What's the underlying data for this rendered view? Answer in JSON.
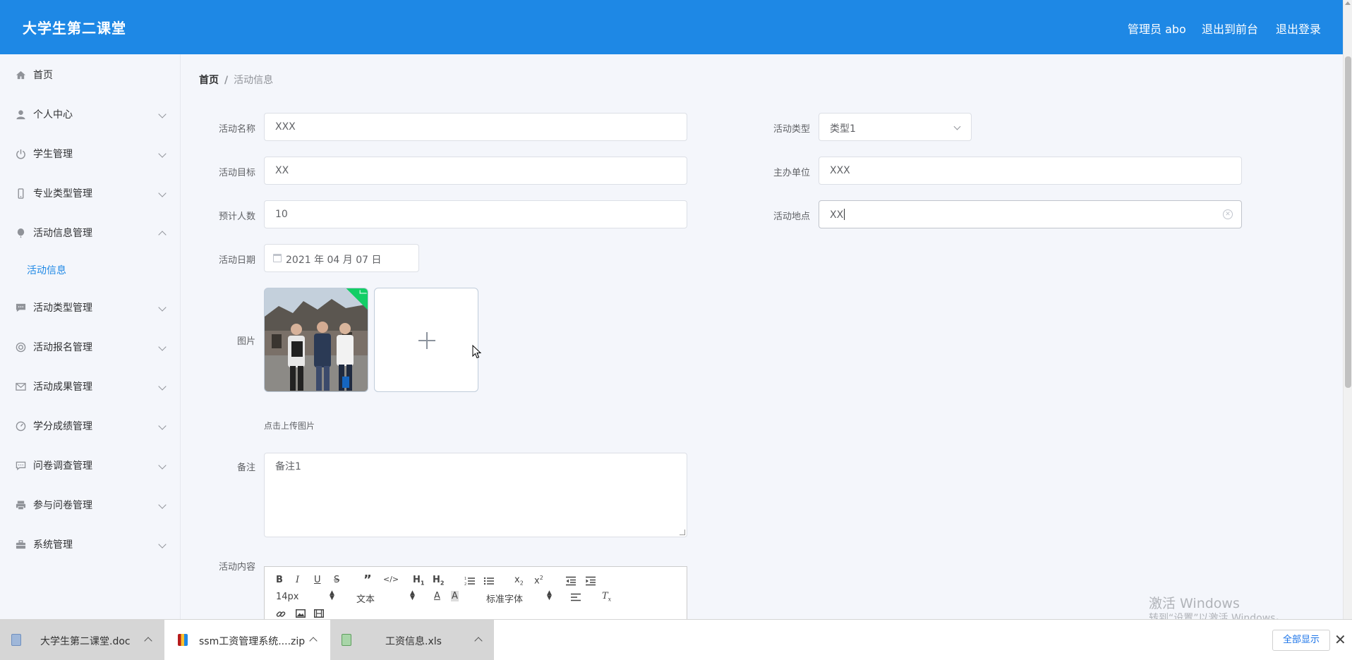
{
  "header": {
    "logo": "大学生第二课堂",
    "user": "管理员 abo",
    "to_front": "退出到前台",
    "logout": "退出登录"
  },
  "sidebar": {
    "items": [
      {
        "label": "首页",
        "icon": "home-icon"
      },
      {
        "label": "个人中心",
        "icon": "user-icon"
      },
      {
        "label": "学生管理",
        "icon": "power-icon"
      },
      {
        "label": "专业类型管理",
        "icon": "phone-icon"
      },
      {
        "label": "活动信息管理",
        "icon": "balloon-icon",
        "expanded": true
      },
      {
        "label": "活动类型管理",
        "icon": "chat-icon"
      },
      {
        "label": "活动报名管理",
        "icon": "lifebuoy-icon"
      },
      {
        "label": "活动成果管理",
        "icon": "mail-icon"
      },
      {
        "label": "学分成绩管理",
        "icon": "gauge-icon"
      },
      {
        "label": "问卷调查管理",
        "icon": "comment-icon"
      },
      {
        "label": "参与问卷管理",
        "icon": "printer-icon"
      },
      {
        "label": "系统管理",
        "icon": "briefcase-icon"
      }
    ],
    "sub_active": "活动信息"
  },
  "breadcrumb": {
    "home": "首页",
    "sep": "/",
    "current": "活动信息"
  },
  "form": {
    "name_label": "活动名称",
    "name_value": "XXX",
    "type_label": "活动类型",
    "type_value": "类型1",
    "goal_label": "活动目标",
    "goal_value": "XX",
    "host_label": "主办单位",
    "host_value": "XXX",
    "count_label": "预计人数",
    "count_value": "10",
    "place_label": "活动地点",
    "place_value": "XX",
    "date_label": "活动日期",
    "date_value": "2021 年 04 月 07 日",
    "image_label": "图片",
    "upload_tip": "点击上传图片",
    "remark_label": "备注",
    "remark_value": "备注1",
    "content_label": "活动内容"
  },
  "editor": {
    "font_size": "14px",
    "text_style": "文本",
    "font_family": "标准字体"
  },
  "watermark": {
    "line1": "激活 Windows",
    "line2": "转到“设置”以激活 Windows。"
  },
  "downloads": {
    "items": [
      "大学生第二课堂.doc",
      "ssm工资管理系统....zip",
      "工资信息.xls"
    ],
    "show_all": "全部显示"
  },
  "colors": {
    "header": "#1e88e5",
    "accent": "#1e88e5",
    "success": "#13ce66"
  }
}
